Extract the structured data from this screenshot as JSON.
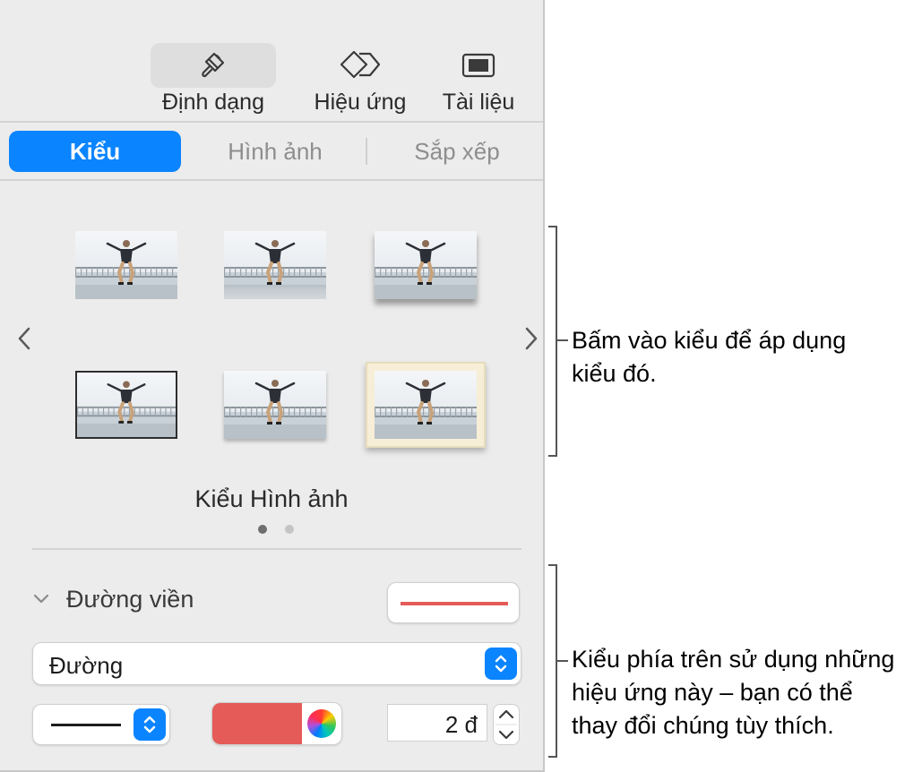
{
  "toolbar": {
    "items": [
      {
        "label": "Định dạng",
        "icon": "paintbrush-icon",
        "active": true
      },
      {
        "label": "Hiệu ứng",
        "icon": "diamond-icon",
        "active": false
      },
      {
        "label": "Tài liệu",
        "icon": "document-icon",
        "active": false
      }
    ]
  },
  "tabs": [
    {
      "label": "Kiểu",
      "active": true
    },
    {
      "label": "Hình ảnh",
      "active": false
    },
    {
      "label": "Sắp xếp",
      "active": false
    }
  ],
  "styles": {
    "title": "Kiểu Hình ảnh",
    "page_count": 2,
    "current_page": 1,
    "thumbnails": [
      "plain",
      "reflection",
      "shadow",
      "thin-border",
      "soft-border",
      "cream-frame"
    ]
  },
  "border_section": {
    "heading": "Đường viền",
    "line_type": "Đường",
    "width_value": "2 đ",
    "color": "#e45b57"
  },
  "callouts": {
    "top_line1": "Bấm vào kiểu để áp dụng",
    "top_line2": "kiểu đó.",
    "bottom_line1": "Kiểu phía trên sử dụng những",
    "bottom_line2": "hiệu ứng này – bạn có thể",
    "bottom_line3": "thay đổi chúng tùy thích."
  },
  "colors": {
    "accent": "#0a84ff",
    "panel_bg": "#ececec",
    "stroke_red": "#e45b57"
  }
}
